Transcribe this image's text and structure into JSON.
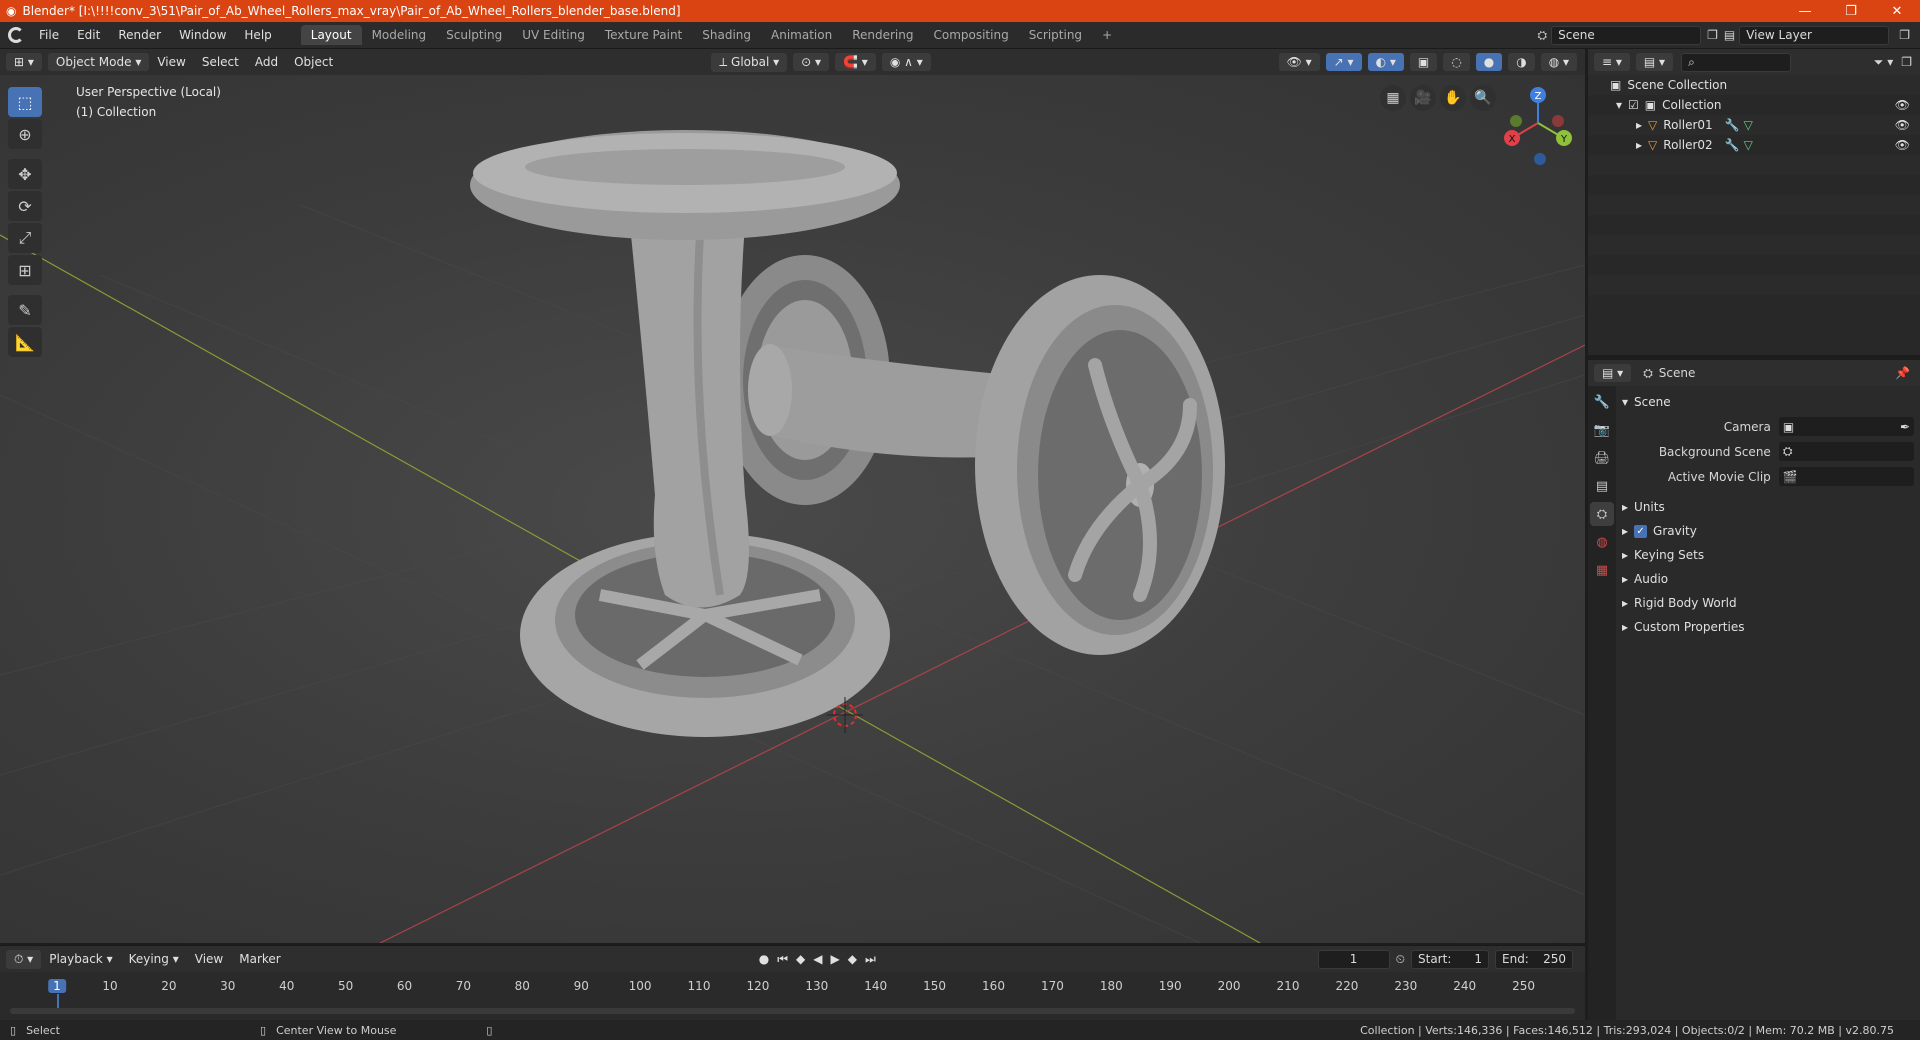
{
  "window": {
    "title": "Blender* [I:\\!!!!conv_3\\51\\Pair_of_Ab_Wheel_Rollers_max_vray\\Pair_of_Ab_Wheel_Rollers_blender_base.blend]",
    "minimize": "—",
    "maximize": "❐",
    "close": "✕"
  },
  "menubar": {
    "menus": [
      "File",
      "Edit",
      "Render",
      "Window",
      "Help"
    ],
    "workspaces": [
      "Layout",
      "Modeling",
      "Sculpting",
      "UV Editing",
      "Texture Paint",
      "Shading",
      "Animation",
      "Rendering",
      "Compositing",
      "Scripting"
    ],
    "active_workspace": "Layout",
    "add_tab": "+",
    "scene_label": "Scene",
    "view_layer_label": "View Layer"
  },
  "viewport_header": {
    "mode": "Object Mode",
    "menus": [
      "View",
      "Select",
      "Add",
      "Object"
    ],
    "transform_orientation": "Global"
  },
  "viewport": {
    "perspective_label": "User Perspective (Local)",
    "collection_label": "(1) Collection",
    "gizmo": {
      "x": "X",
      "y": "Y",
      "z": "Z"
    }
  },
  "outliner": {
    "root": "Scene Collection",
    "collection": "Collection",
    "objects": [
      "Roller01",
      "Roller02"
    ]
  },
  "properties": {
    "header": "Scene",
    "section": "Scene",
    "rows": [
      {
        "label": "Camera"
      },
      {
        "label": "Background Scene"
      },
      {
        "label": "Active Movie Clip"
      }
    ],
    "subsections": [
      "Units",
      "Gravity",
      "Keying Sets",
      "Audio",
      "Rigid Body World",
      "Custom Properties"
    ],
    "gravity_enabled": true
  },
  "timeline": {
    "menus": [
      "Playback",
      "Keying",
      "View",
      "Marker"
    ],
    "current_frame": "1",
    "start_label": "Start:",
    "start": "1",
    "end_label": "End:",
    "end": "250",
    "ticks": [
      "1",
      "10",
      "20",
      "30",
      "40",
      "50",
      "60",
      "70",
      "80",
      "90",
      "100",
      "110",
      "120",
      "130",
      "140",
      "150",
      "160",
      "170",
      "180",
      "190",
      "200",
      "210",
      "220",
      "230",
      "240",
      "250"
    ]
  },
  "statusbar": {
    "left": "Select",
    "middle": "Center View to Mouse",
    "right": "Collection | Verts:146,336 | Faces:146,512 | Tris:293,024 | Objects:0/2 | Mem: 70.2 MB | v2.80.75"
  },
  "colors": {
    "titlebar": "#d94412",
    "accent": "#4772b3",
    "x_axis": "#e0404a",
    "y_axis": "#8fc23a",
    "z_axis": "#3f7fe0"
  }
}
